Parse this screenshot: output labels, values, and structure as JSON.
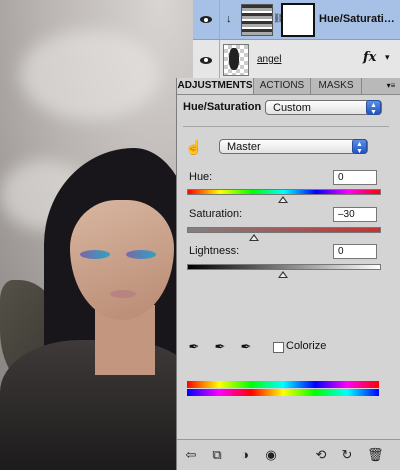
{
  "layers": {
    "adjustment_layer": {
      "name": "Hue/Saturati…"
    },
    "image_layer": {
      "name": "angel",
      "fx": "fx"
    }
  },
  "adjustments_panel": {
    "tabs": [
      {
        "label": "ADJUSTMENTS"
      },
      {
        "label": "ACTIONS"
      },
      {
        "label": "MASKS"
      }
    ],
    "title": "Hue/Saturation",
    "preset_value": "Custom",
    "channel_value": "Master",
    "hue": {
      "label": "Hue:",
      "value": "0",
      "fraction": 0.5
    },
    "saturation": {
      "label": "Saturation:",
      "value": "–30",
      "fraction": 0.35
    },
    "lightness": {
      "label": "Lightness:",
      "value": "0",
      "fraction": 0.5
    },
    "colorize": {
      "label": "Colorize",
      "checked": false
    }
  }
}
